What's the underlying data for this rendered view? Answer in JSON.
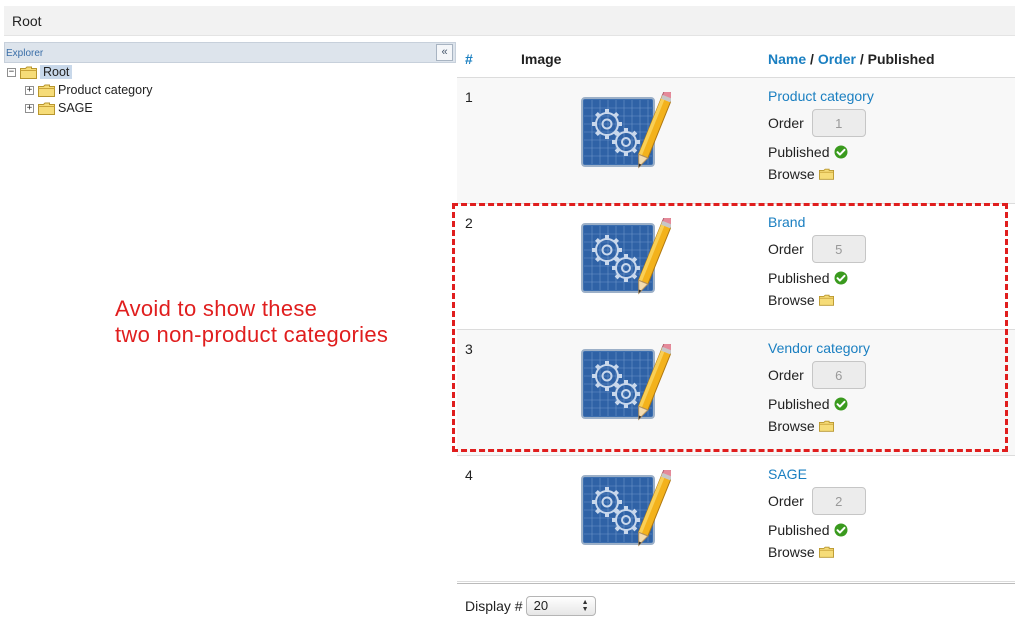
{
  "topbar": {
    "title": "Root"
  },
  "explorer": {
    "title": "Explorer",
    "collapse_glyph": "«",
    "tree": {
      "root": {
        "label": "Root",
        "toggle": "−"
      },
      "children": [
        {
          "label": "Product category",
          "toggle": "+"
        },
        {
          "label": "SAGE",
          "toggle": "+"
        }
      ]
    }
  },
  "grid": {
    "headers": {
      "num": "#",
      "image": "Image",
      "name": "Name",
      "sep1": "/",
      "order": "Order",
      "sep2": "/",
      "published": "Published"
    },
    "labels": {
      "order": "Order",
      "published": "Published",
      "browse": "Browse"
    },
    "rows": [
      {
        "num": "1",
        "name": "Product category",
        "order": "1"
      },
      {
        "num": "2",
        "name": "Brand",
        "order": "5"
      },
      {
        "num": "3",
        "name": "Vendor category",
        "order": "6"
      },
      {
        "num": "4",
        "name": "SAGE",
        "order": "2"
      }
    ],
    "footer": {
      "display_label": "Display #",
      "display_value": "20"
    }
  },
  "annotation": {
    "line1": "Avoid to show these",
    "line2": "two non-product categories",
    "color": "#e01e1e"
  },
  "colors": {
    "link": "#1a7fc1",
    "published_check": "#3a9a1e",
    "folder": "#f4d35e"
  }
}
